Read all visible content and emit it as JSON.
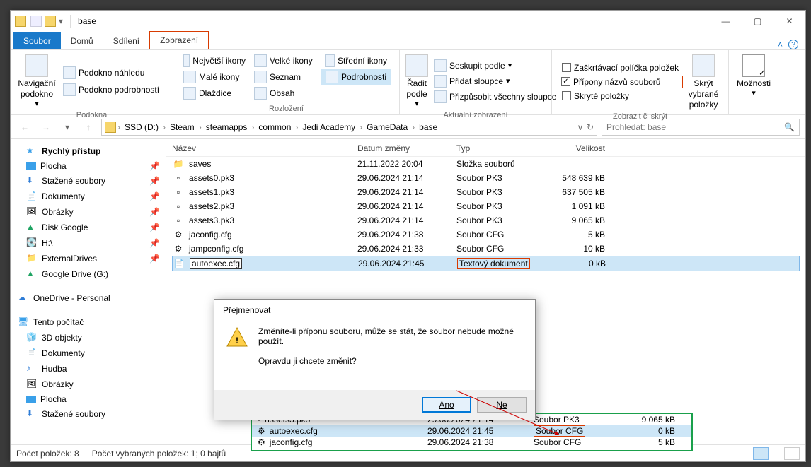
{
  "window": {
    "title": "base"
  },
  "tabs": {
    "file": "Soubor",
    "home": "Domů",
    "share": "Sdílení",
    "view": "Zobrazení"
  },
  "ribbon": {
    "panes_label": "Podokna",
    "nav_pane": "Navigační\npodokno",
    "preview_pane": "Podokno náhledu",
    "details_pane": "Podokno podrobností",
    "layout_label": "Rozložení",
    "xl_icons": "Největší ikony",
    "l_icons": "Velké ikony",
    "m_icons": "Střední ikony",
    "s_icons": "Malé ikony",
    "list": "Seznam",
    "details": "Podrobnosti",
    "tiles": "Dlaždice",
    "content": "Obsah",
    "curview_label": "Aktuální zobrazení",
    "sort": "Řadit\npodle",
    "group": "Seskupit podle",
    "addcols": "Přidat sloupce",
    "sizecols": "Přizpůsobit všechny sloupce",
    "showhide_label": "Zobrazit či skrýt",
    "check_boxes": "Zaškrtávací políčka položek",
    "file_ext": "Přípony názvů souborů",
    "hidden": "Skryté položky",
    "hide_sel": "Skrýt vybrané\npoložky",
    "options": "Možnosti"
  },
  "breadcrumbs": [
    "SSD (D:)",
    "Steam",
    "steamapps",
    "common",
    "Jedi Academy",
    "GameData",
    "base"
  ],
  "search_placeholder": "Prohledat: base",
  "nav": {
    "quick": "Rychlý přístup",
    "desktop": "Plocha",
    "downloads": "Stažené soubory",
    "documents": "Dokumenty",
    "pictures": "Obrázky",
    "gdisk": "Disk Google",
    "h": "H:\\",
    "ext": "ExternalDrives",
    "gdrive": "Google Drive (G:)",
    "onedrive": "OneDrive - Personal",
    "thispc": "Tento počítač",
    "obj3d": "3D objekty",
    "docs2": "Dokumenty",
    "music": "Hudba",
    "pics2": "Obrázky",
    "desk2": "Plocha",
    "dl2": "Stažené soubory"
  },
  "columns": {
    "name": "Název",
    "date": "Datum změny",
    "type": "Typ",
    "size": "Velikost"
  },
  "files": [
    {
      "name": "saves",
      "date": "21.11.2022 20:04",
      "type": "Složka souborů",
      "size": "",
      "kind": "folder"
    },
    {
      "name": "assets0.pk3",
      "date": "29.06.2024 21:14",
      "type": "Soubor PK3",
      "size": "548 639 kB",
      "kind": "file"
    },
    {
      "name": "assets1.pk3",
      "date": "29.06.2024 21:14",
      "type": "Soubor PK3",
      "size": "637 505 kB",
      "kind": "file"
    },
    {
      "name": "assets2.pk3",
      "date": "29.06.2024 21:14",
      "type": "Soubor PK3",
      "size": "1 091 kB",
      "kind": "file"
    },
    {
      "name": "assets3.pk3",
      "date": "29.06.2024 21:14",
      "type": "Soubor PK3",
      "size": "9 065 kB",
      "kind": "file"
    },
    {
      "name": "jaconfig.cfg",
      "date": "29.06.2024 21:38",
      "type": "Soubor CFG",
      "size": "5 kB",
      "kind": "cfg"
    },
    {
      "name": "jampconfig.cfg",
      "date": "29.06.2024 21:33",
      "type": "Soubor CFG",
      "size": "10 kB",
      "kind": "cfg"
    },
    {
      "name": "autoexec.cfg",
      "date": "29.06.2024 21:45",
      "type": "Textový dokument",
      "size": "0 kB",
      "kind": "txt",
      "rename": true,
      "selected": true
    }
  ],
  "dialog": {
    "title": "Přejmenovat",
    "line1": "Změníte-li příponu souboru, může se stát, že soubor nebude možné použít.",
    "line2": "Opravdu ji chcete změnit?",
    "yes": "Ano",
    "no": "Ne"
  },
  "inset": [
    {
      "name": "assets3.pk3",
      "date": "29.06.2024 21:14",
      "type": "Soubor PK3",
      "size": "9 065 kB"
    },
    {
      "name": "autoexec.cfg",
      "date": "29.06.2024 21:45",
      "type": "Soubor CFG",
      "size": "0 kB",
      "sel": true,
      "hl": true
    },
    {
      "name": "jaconfig.cfg",
      "date": "29.06.2024 21:38",
      "type": "Soubor CFG",
      "size": "5 kB"
    }
  ],
  "status": {
    "count": "Počet položek: 8",
    "sel": "Počet vybraných položek: 1; 0 bajtů"
  }
}
